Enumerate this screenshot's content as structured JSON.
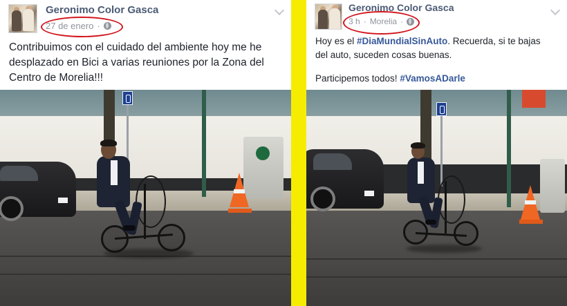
{
  "posts": [
    {
      "author": "Geronimo Color Gasca",
      "timestamp": "27 de enero",
      "separator": "·",
      "privacy_icon": "globe-icon",
      "menu_icon": "chevron-down-icon",
      "text_lines": [
        "Contribuimos con el cuidado del ambiente hoy me he",
        "desplazado en Bici a varias reuniones por la Zona del",
        "Centro de Morelia!!!"
      ],
      "photo_icon": "man-riding-bicycle-photo"
    },
    {
      "author": "Geronimo Color Gasca",
      "timestamp": "3 h",
      "separator": "·",
      "location": "Morelia",
      "separator2": "·",
      "privacy_icon": "globe-icon",
      "menu_icon": "chevron-down-icon",
      "text": {
        "line1_prefix": "Hoy es el ",
        "line1_hashtag": "#DiaMundialSinAuto",
        "line1_suffix": ". Recuerda, si te bajas",
        "line2": "del auto, suceden cosas buenas.",
        "line3_prefix": "Participemos todos! ",
        "line3_hashtag": "#VamosADarle"
      },
      "photo_icon": "man-riding-bicycle-photo"
    }
  ],
  "annotations": {
    "highlight_color": "#d3141c",
    "divider_color": "#f5ec00"
  },
  "colors": {
    "author": "#4b5a75",
    "meta": "#90949c",
    "hashtag": "#365899",
    "text": "#1d2129"
  }
}
